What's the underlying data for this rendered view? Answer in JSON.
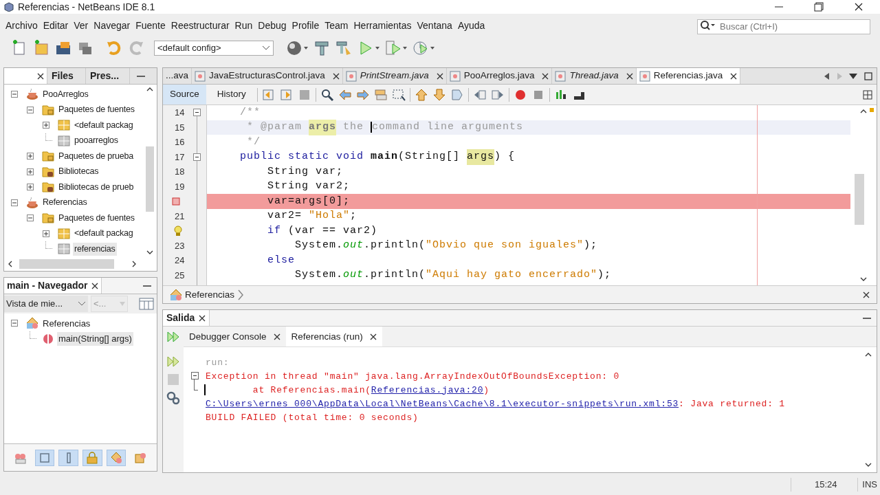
{
  "window": {
    "title": "Referencias - NetBeans IDE 8.1"
  },
  "menu": [
    "Archivo",
    "Editar",
    "Ver",
    "Navegar",
    "Fuente",
    "Reestructurar",
    "Run",
    "Debug",
    "Profile",
    "Team",
    "Herramientas",
    "Ventana",
    "Ayuda"
  ],
  "search": {
    "placeholder": "Buscar (Ctrl+I)"
  },
  "toolbar": {
    "config": "<default config>"
  },
  "projects_panel": {
    "tabs": [
      {
        "label": "Files",
        "selected": false
      },
      {
        "label": "Pres...",
        "selected": false
      }
    ],
    "tree": [
      {
        "label": "PooArreglos",
        "kind": "project",
        "expanded": true,
        "selected": false,
        "children": [
          {
            "label": "Paquetes de fuentes",
            "kind": "folder",
            "expanded": true,
            "selected": false,
            "children": [
              {
                "label": "<default packag",
                "kind": "package",
                "expanded": false,
                "selected": false
              },
              {
                "label": "pooarreglos",
                "kind": "package-empty",
                "selected": false
              }
            ]
          },
          {
            "label": "Paquetes de prueba",
            "kind": "folder",
            "expanded": false,
            "selected": false
          },
          {
            "label": "Bibliotecas",
            "kind": "library",
            "expanded": false,
            "selected": false
          },
          {
            "label": "Bibliotecas de prueb",
            "kind": "library",
            "expanded": false,
            "selected": false
          }
        ]
      },
      {
        "label": "Referencias",
        "kind": "project",
        "expanded": true,
        "selected": false,
        "children": [
          {
            "label": "Paquetes de fuentes",
            "kind": "folder",
            "expanded": true,
            "selected": false,
            "children": [
              {
                "label": "<default packag",
                "kind": "package",
                "expanded": false,
                "selected": false
              },
              {
                "label": "referencias",
                "kind": "package-empty",
                "selected": true
              }
            ]
          }
        ]
      }
    ]
  },
  "navigator": {
    "title": "main - Navegador",
    "view": "Vista de mie...",
    "filter": "<...",
    "tree": [
      {
        "label": "Referencias",
        "kind": "class",
        "expanded": true,
        "selected": false,
        "children": [
          {
            "label": "main(String[] args)",
            "kind": "method",
            "selected": true
          }
        ]
      }
    ],
    "filters": [
      {
        "kind": "fields",
        "selected": false
      },
      {
        "kind": "square",
        "selected": true
      },
      {
        "kind": "bar",
        "selected": true
      },
      {
        "kind": "lock",
        "selected": true
      },
      {
        "kind": "shapes",
        "selected": true
      },
      {
        "kind": "inherited",
        "selected": false
      }
    ]
  },
  "editor": {
    "tabs": [
      {
        "label": "...ava",
        "kind": "partial",
        "italic": false,
        "selected": false
      },
      {
        "label": "JavaEstructurasControl.java",
        "kind": "file",
        "italic": false,
        "selected": false
      },
      {
        "label": "PrintStream.java",
        "kind": "file",
        "italic": true,
        "selected": false
      },
      {
        "label": "PooArreglos.java",
        "kind": "file",
        "italic": false,
        "selected": false
      },
      {
        "label": "Thread.java",
        "kind": "file",
        "italic": true,
        "selected": false
      },
      {
        "label": "Referencias.java",
        "kind": "file",
        "italic": false,
        "selected": true
      }
    ],
    "views": [
      {
        "label": "Source",
        "selected": true
      },
      {
        "label": "History",
        "selected": false
      }
    ],
    "lines": [
      {
        "number": "14",
        "kind": "normal",
        "collapsible": true,
        "segments": [
          {
            "t": "    /**",
            "kind": "comment"
          }
        ]
      },
      {
        "number": "15",
        "kind": "current",
        "collapsible": false,
        "segments": [
          {
            "t": "     * @param ",
            "kind": "comment"
          },
          {
            "t": "args",
            "kind": "comment-mark"
          },
          {
            "t": " the ",
            "kind": "comment"
          },
          {
            "kind": "caret"
          },
          {
            "t": "command line arguments",
            "kind": "comment"
          }
        ]
      },
      {
        "number": "16",
        "kind": "normal",
        "collapsible": false,
        "segments": [
          {
            "t": "     */",
            "kind": "comment"
          }
        ]
      },
      {
        "number": "17",
        "kind": "normal",
        "collapsible": true,
        "segments": [
          {
            "t": "    public static void ",
            "kind": "keyword"
          },
          {
            "t": "main",
            "kind": "bold"
          },
          {
            "t": "(String[] ",
            "kind": "plain"
          },
          {
            "t": "args",
            "kind": "mark"
          },
          {
            "t": ") {",
            "kind": "plain"
          }
        ]
      },
      {
        "number": "18",
        "kind": "normal",
        "collapsible": false,
        "segments": [
          {
            "t": "        String var;",
            "kind": "plain"
          }
        ]
      },
      {
        "number": "19",
        "kind": "normal",
        "collapsible": false,
        "segments": [
          {
            "t": "        String var2;",
            "kind": "plain"
          }
        ]
      },
      {
        "kind": "breakpoint",
        "collapsible": false,
        "segments": [
          {
            "t": "        var=args[0];",
            "kind": "plain"
          }
        ]
      },
      {
        "number": "21",
        "kind": "normal",
        "collapsible": false,
        "segments": [
          {
            "t": "        var2= ",
            "kind": "plain"
          },
          {
            "t": "\"Hola\"",
            "kind": "string"
          },
          {
            "t": ";",
            "kind": "plain"
          }
        ]
      },
      {
        "kind": "hint",
        "collapsible": false,
        "segments": [
          {
            "t": "        if",
            "kind": "keyword"
          },
          {
            "t": " (var == var2)",
            "kind": "plain"
          }
        ]
      },
      {
        "number": "23",
        "kind": "normal",
        "collapsible": false,
        "segments": [
          {
            "t": "            System.",
            "kind": "plain"
          },
          {
            "t": "out",
            "kind": "field"
          },
          {
            "t": ".println(",
            "kind": "plain"
          },
          {
            "t": "\"Obvio que son iguales\"",
            "kind": "string"
          },
          {
            "t": ");",
            "kind": "plain"
          }
        ]
      },
      {
        "number": "24",
        "kind": "normal",
        "collapsible": false,
        "segments": [
          {
            "t": "        else",
            "kind": "keyword"
          }
        ]
      },
      {
        "number": "25",
        "kind": "normal",
        "collapsible": false,
        "segments": [
          {
            "t": "            System.",
            "kind": "plain"
          },
          {
            "t": "out",
            "kind": "field"
          },
          {
            "t": ".println(",
            "kind": "plain"
          },
          {
            "t": "\"Aqui hay gato encerrado\"",
            "kind": "string"
          },
          {
            "t": ");",
            "kind": "plain"
          }
        ]
      }
    ],
    "breadcrumb": "Referencias"
  },
  "output": {
    "title": "Salida",
    "tabs": [
      {
        "label": "Debugger Console",
        "selected": false
      },
      {
        "label": "Referencias (run)",
        "selected": true
      }
    ],
    "lines": [
      {
        "collapsible": false,
        "segments": [
          {
            "t": "run:",
            "kind": "muted"
          }
        ]
      },
      {
        "collapsible": true,
        "segments": [
          {
            "t": "Exception in thread \"main\" java.lang.ArrayIndexOutOfBoundsException: 0",
            "kind": "error"
          }
        ]
      },
      {
        "collapsible": false,
        "segments": [
          {
            "kind": "caret"
          },
          {
            "t": "        at Referencias.main(",
            "kind": "error"
          },
          {
            "t": "Referencias.java:20",
            "kind": "link"
          },
          {
            "t": ")",
            "kind": "error"
          }
        ]
      },
      {
        "collapsible": false,
        "segments": [
          {
            "t": "C:\\Users\\ernes_000\\AppData\\Local\\NetBeans\\Cache\\8.1\\executor-snippets\\run.xml:53",
            "kind": "link"
          },
          {
            "t": ": Java returned: 1",
            "kind": "error"
          }
        ]
      },
      {
        "collapsible": false,
        "segments": [
          {
            "t": "BUILD FAILED (total time: 0 seconds)",
            "kind": "error"
          }
        ]
      }
    ]
  },
  "status_bar": {
    "time": "15:24",
    "mode": "INS"
  }
}
